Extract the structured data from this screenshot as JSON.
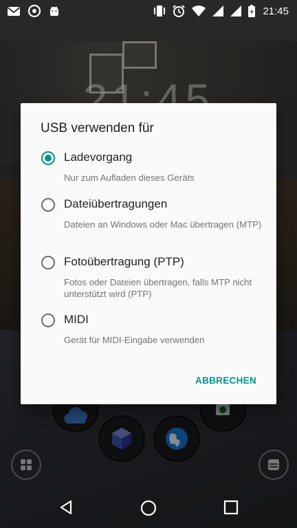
{
  "status_bar": {
    "time": "21:45",
    "left_icons": [
      "gmail-icon",
      "sync-circle-icon",
      "android-icon"
    ],
    "right_icons": [
      "vibrate-icon",
      "alarm-icon",
      "wifi-icon",
      "signal-icon",
      "signal-icon",
      "battery-charging-icon"
    ]
  },
  "lockscreen": {
    "clock": "21:45"
  },
  "dialog": {
    "title": "USB verwenden für",
    "options": [
      {
        "label": "Ladevorgang",
        "description": "Nur zum Aufladen dieses Geräts",
        "selected": true
      },
      {
        "label": "Dateiübertragungen",
        "description": "Dateien an Windows oder Mac übertragen (MTP)",
        "selected": false
      },
      {
        "label": "Fotoübertragung (PTP)",
        "description": "Fotos oder Dateien übertragen, falls MTP nicht unterstützt wird (PTP)",
        "selected": false
      },
      {
        "label": "MIDI",
        "description": "Gerät für MIDI-Eingabe verwenden",
        "selected": false
      }
    ],
    "cancel_label": "ABBRECHEN"
  },
  "colors": {
    "accent": "#009688",
    "dialog_bg": "#fafafa",
    "title_text": "#212121",
    "secondary_text": "#737373"
  },
  "navigation": {
    "back": "back-icon",
    "home": "home-icon",
    "recents": "recents-icon"
  }
}
